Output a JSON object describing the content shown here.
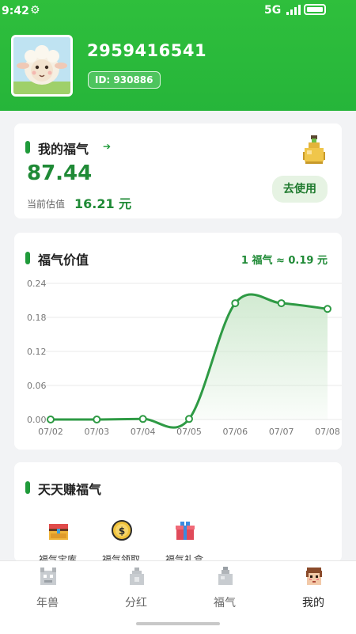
{
  "status_bar": {
    "time": "9:42",
    "network": "5G"
  },
  "profile": {
    "user_number": "2959416541",
    "id_label": "ID: 930886"
  },
  "fortune_card": {
    "title": "我的福气",
    "balance": "87.44",
    "estimate_label": "当前估值",
    "estimate_value": "16.21 元",
    "use_button": "去使用"
  },
  "value_card": {
    "title": "福气价值",
    "rate": "1 福气 ≈ 0.19 元"
  },
  "chart_data": {
    "type": "line",
    "x": [
      "07/02",
      "07/03",
      "07/04",
      "07/05",
      "07/06",
      "07/07",
      "07/08"
    ],
    "series": [
      {
        "values": [
          0.0,
          0.0,
          0.001,
          0.001,
          0.205,
          0.205,
          0.195
        ]
      }
    ],
    "yticks": [
      "0.00",
      "0.06",
      "0.12",
      "0.18",
      "0.24"
    ],
    "ylim": [
      0,
      0.24
    ],
    "grid": true,
    "colors": {
      "line": "#2e9a44",
      "fill": "#cfe9cf"
    }
  },
  "tasks_card": {
    "title": "天天赚福气",
    "items": [
      {
        "label": "福气宝库",
        "icon": "treasure-chest-icon"
      },
      {
        "label": "福气领取",
        "icon": "coin-icon"
      },
      {
        "label": "福气礼盒",
        "icon": "gift-box-icon"
      }
    ]
  },
  "tabs": [
    {
      "label": "年兽",
      "icon": "beast-icon"
    },
    {
      "label": "分红",
      "icon": "dividend-bag-icon"
    },
    {
      "label": "福气",
      "icon": "fortune-jar-icon"
    },
    {
      "label": "我的",
      "icon": "profile-avatar-icon"
    }
  ],
  "colors": {
    "brand_green": "#2fbf3c",
    "accent_green": "#1f8a36"
  }
}
